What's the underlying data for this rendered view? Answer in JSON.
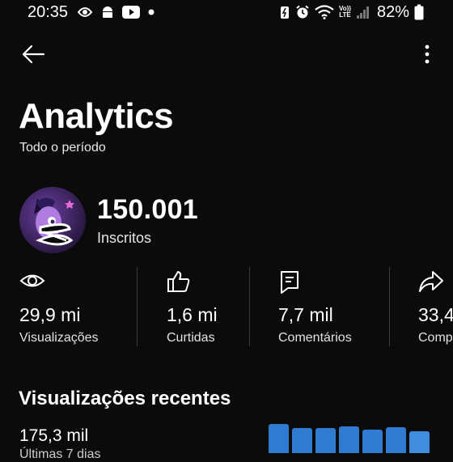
{
  "status_bar": {
    "time": "20:35",
    "battery_percent": "82%",
    "network_label_top": "Vo))",
    "network_label_bottom": "LTE"
  },
  "header": {
    "title": "Analytics",
    "period": "Todo o período"
  },
  "channel": {
    "subscribers": "150.001",
    "subscribers_label": "Inscritos"
  },
  "stats": [
    {
      "icon": "eye-icon",
      "value": "29,9 mi",
      "label": "Visualizações"
    },
    {
      "icon": "thumbs-up-icon",
      "value": "1,6 mi",
      "label": "Curtidas"
    },
    {
      "icon": "comment-icon",
      "value": "7,7 mil",
      "label": "Comentários"
    },
    {
      "icon": "share-icon",
      "value": "33,4",
      "label": "Comp"
    }
  ],
  "recent": {
    "title": "Visualizações recentes",
    "value": "175,3 mil",
    "sublabel": "Últimas 7 dias"
  },
  "colors": {
    "background": "#0b0b0b",
    "bar": "#2f7bd1"
  }
}
